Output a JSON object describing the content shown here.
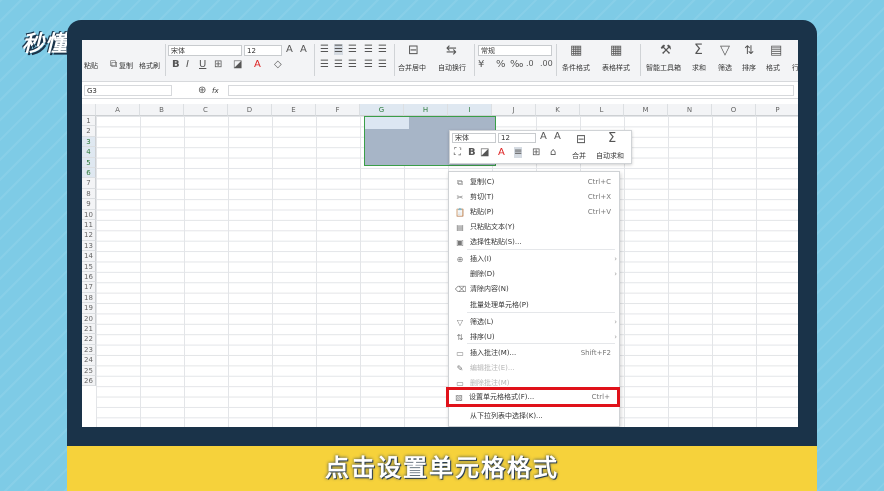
{
  "logo": "秒懂视频",
  "caption": "点击设置单元格格式",
  "ribbon": {
    "paste": "粘贴",
    "copy": "复制",
    "format_painter": "格式刷",
    "font_name": "宋体",
    "font_size": "12",
    "merge_center": "合并居中",
    "auto_wrap": "自动换行",
    "number_format": "常规",
    "conditional_format": "条件格式",
    "table_style": "表格样式",
    "smart_toolbox": "智能工具箱",
    "sum": "求和",
    "filter": "筛选",
    "sort": "排序",
    "format": "格式",
    "row_col": "行"
  },
  "formula_bar": {
    "name_box": "G3",
    "fx": "fx"
  },
  "columns": [
    "A",
    "B",
    "C",
    "D",
    "E",
    "F",
    "G",
    "H",
    "I",
    "J",
    "K",
    "L",
    "M",
    "N",
    "O",
    "P"
  ],
  "rows": [
    "1",
    "2",
    "3",
    "4",
    "5",
    "6",
    "7",
    "8",
    "9",
    "10",
    "11",
    "12",
    "13",
    "14",
    "15",
    "16",
    "17",
    "18",
    "19",
    "20",
    "21",
    "22",
    "23",
    "24",
    "25",
    "26"
  ],
  "mini_toolbar": {
    "font_name": "宋体",
    "font_size": "12",
    "merge": "合并",
    "auto_sum": "自动求和"
  },
  "context_menu": [
    {
      "label": "复制(C)",
      "shortcut": "Ctrl+C",
      "icon": "copy-icon"
    },
    {
      "label": "剪切(T)",
      "shortcut": "Ctrl+X",
      "icon": "scissors-icon"
    },
    {
      "label": "粘贴(P)",
      "shortcut": "Ctrl+V",
      "icon": "paste-icon"
    },
    {
      "label": "只粘贴文本(Y)",
      "shortcut": "",
      "icon": "paste-text-icon"
    },
    {
      "label": "选择性粘贴(S)...",
      "shortcut": "",
      "icon": "paste-special-icon"
    },
    {
      "label": "插入(I)",
      "shortcut": "",
      "icon": "insert-icon"
    },
    {
      "label": "删除(D)",
      "shortcut": "",
      "icon": ""
    },
    {
      "label": "清除内容(N)",
      "shortcut": "",
      "icon": "eraser-icon"
    },
    {
      "label": "批量处理单元格(P)",
      "shortcut": "",
      "icon": ""
    },
    {
      "label": "筛选(L)",
      "shortcut": "",
      "icon": "filter-icon"
    },
    {
      "label": "排序(U)",
      "shortcut": "",
      "icon": "sort-icon"
    },
    {
      "label": "插入批注(M)...",
      "shortcut": "Shift+F2",
      "icon": "comment-icon"
    },
    {
      "label": "编辑批注(E)...",
      "shortcut": "",
      "icon": "edit-comment-icon"
    },
    {
      "label": "删除批注(M)",
      "shortcut": "",
      "icon": "delete-comment-icon"
    },
    {
      "label": "设置单元格格式(F)...",
      "shortcut": "Ctrl+",
      "icon": "format-cells-icon"
    },
    {
      "label": "从下拉列表中选择(K)...",
      "shortcut": "",
      "icon": ""
    }
  ],
  "colors": {
    "selection_fill": "#a7b5c7",
    "selection_border": "#3a9e49",
    "highlight_box": "#e0121a",
    "caption_bg": "#f6d23b",
    "frame": "#1a3349"
  }
}
